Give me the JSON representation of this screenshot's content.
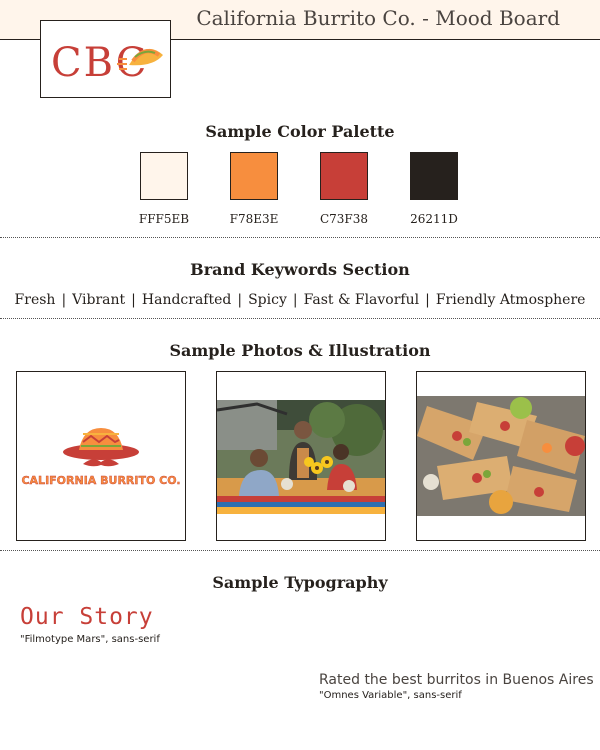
{
  "header": {
    "title": "California Burrito Co. - Mood Board"
  },
  "logo": {
    "text": "CBC"
  },
  "palette": {
    "title": "Sample Color Palette",
    "swatches": [
      {
        "hex": "#FFF5EB",
        "label": "FFF5EB"
      },
      {
        "hex": "#F78E3E",
        "label": "F78E3E"
      },
      {
        "hex": "#C73F38",
        "label": "C73F38"
      },
      {
        "hex": "#26211D",
        "label": "26211D"
      }
    ]
  },
  "keywords": {
    "title": "Brand Keywords Section",
    "items": [
      "Fresh",
      "Vibrant",
      "Handcrafted",
      "Spicy",
      "Fast & Flavorful",
      "Friendly Atmosphere"
    ]
  },
  "photos": {
    "title": "Sample Photos & Illustration",
    "logo_wordmark": "CALIFORNIA BURRITO CO."
  },
  "typography": {
    "title": "Sample Typography",
    "display_sample": "Our Story",
    "display_font_caption": "\"Filmotype Mars\", sans-serif",
    "body_sample": "Rated the best burritos in Buenos Aires",
    "body_font_caption": "\"Omnes Variable\", sans-serif"
  }
}
